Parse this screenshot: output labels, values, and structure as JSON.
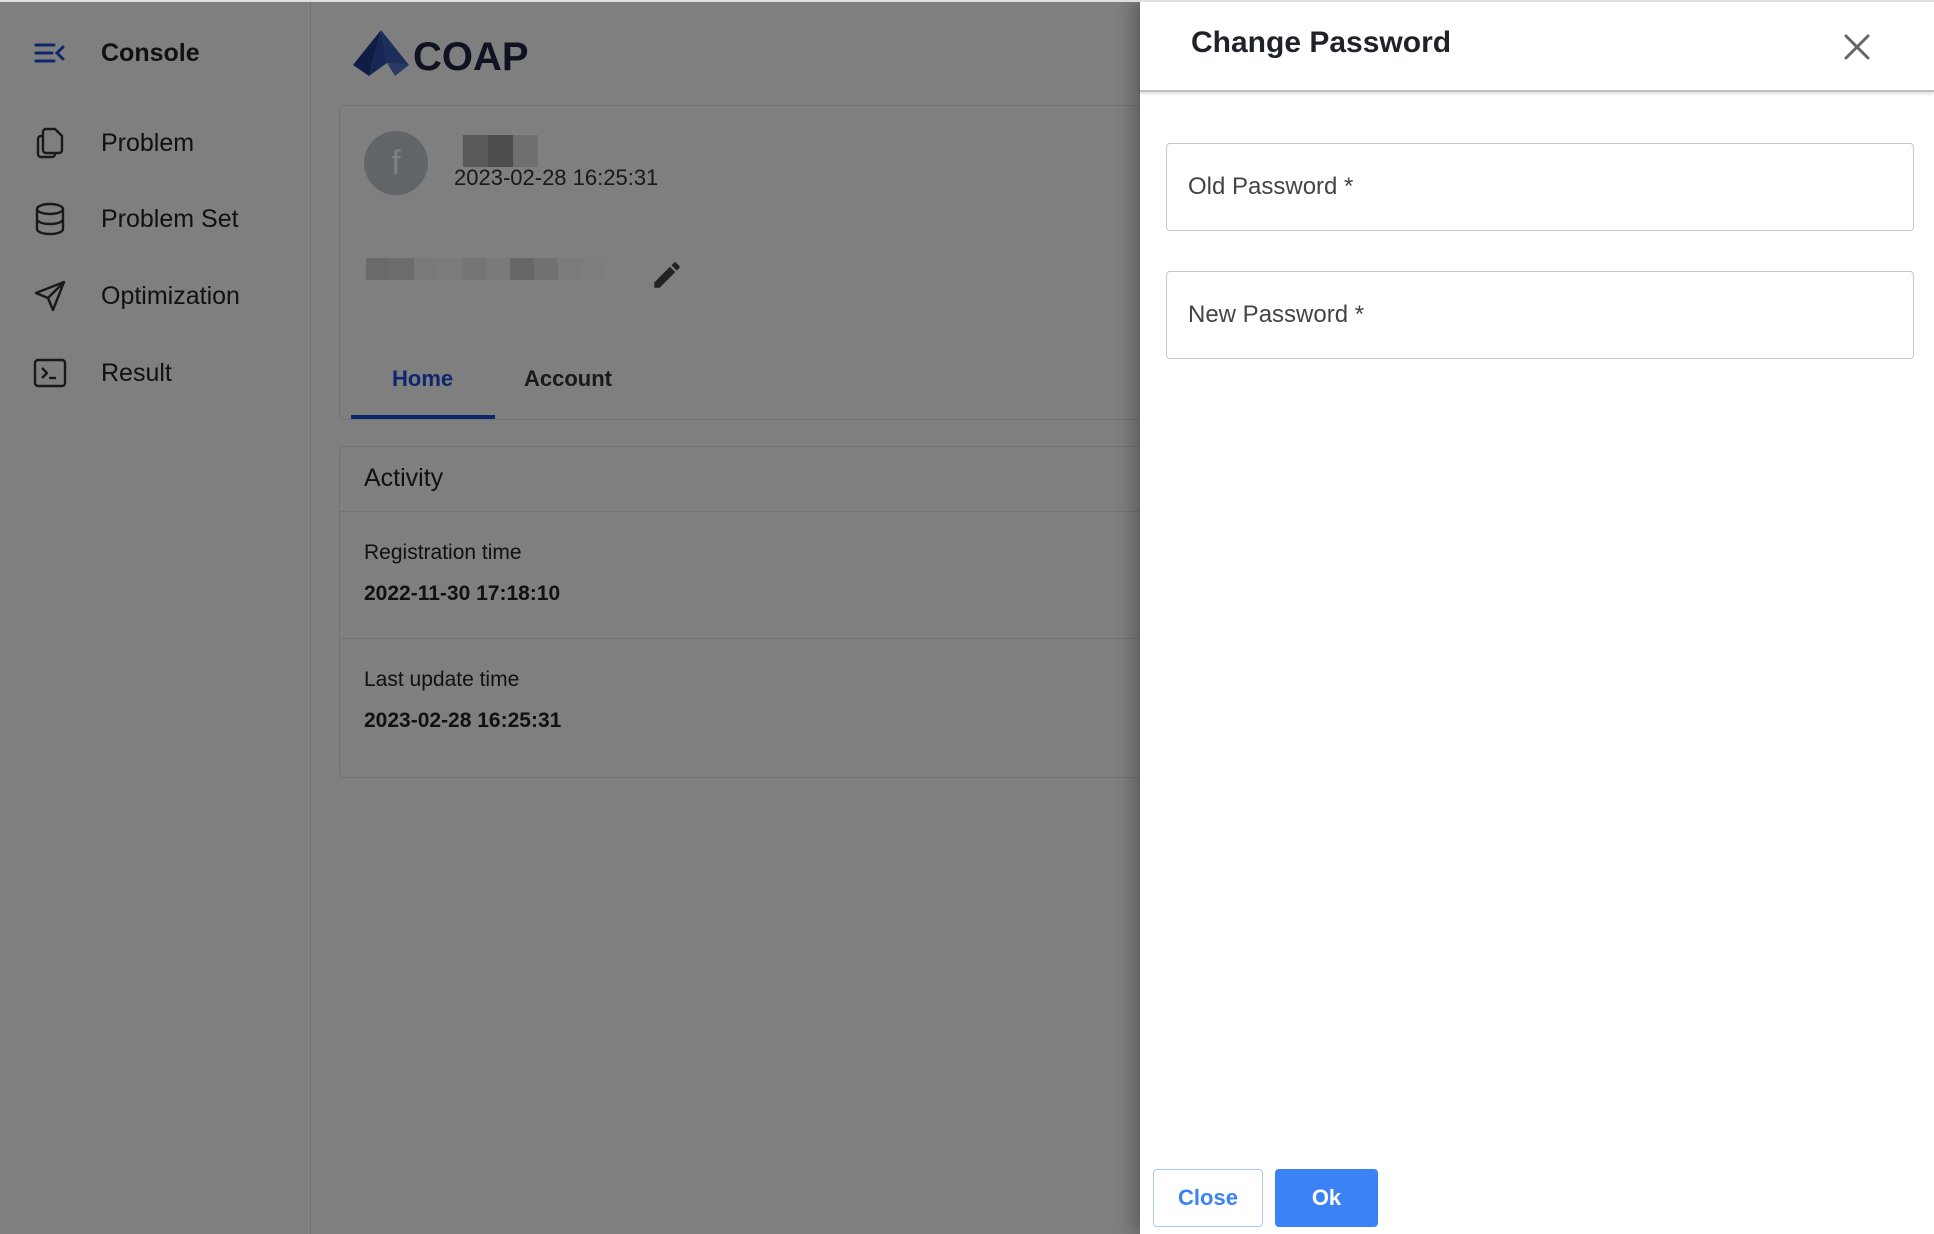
{
  "sidebar": {
    "title": "Console",
    "items": [
      {
        "label": "Problem",
        "icon": "copy-icon"
      },
      {
        "label": "Problem Set",
        "icon": "database-icon"
      },
      {
        "label": "Optimization",
        "icon": "send-icon"
      },
      {
        "label": "Result",
        "icon": "terminal-icon"
      }
    ],
    "accent": "#1d4ed8"
  },
  "header": {
    "logo_text": "COAP"
  },
  "profile": {
    "avatar_letter": "f",
    "joined": "2023-02-28 16:25:31",
    "tabs": [
      {
        "label": "Home",
        "active": true
      },
      {
        "label": "Account",
        "active": false
      }
    ]
  },
  "activity": {
    "title": "Activity",
    "rows": [
      {
        "label": "Registration time",
        "value": "2022-11-30 17:18:10"
      },
      {
        "label": "Last update time",
        "value": "2023-02-28 16:25:31"
      }
    ]
  },
  "drawer": {
    "title": "Change Password",
    "fields": [
      {
        "label": "Old Password *",
        "value": ""
      },
      {
        "label": "New Password *",
        "value": ""
      }
    ],
    "close_label": "Close",
    "ok_label": "Ok",
    "primary_color": "#3b82f6"
  }
}
